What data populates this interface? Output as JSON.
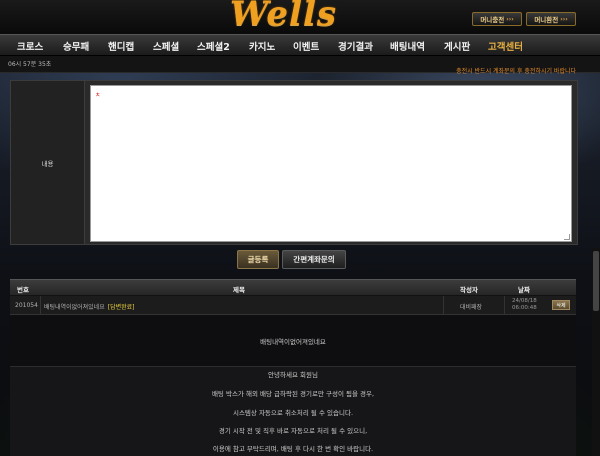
{
  "header": {
    "logo": "Wells",
    "charge_btn": "머니충전",
    "exchange_btn": "머니환전",
    "arrows": "›››"
  },
  "nav": {
    "items": [
      {
        "label": "크로스"
      },
      {
        "label": "승무패"
      },
      {
        "label": "핸디캡"
      },
      {
        "label": "스페셜"
      },
      {
        "label": "스페셜2"
      },
      {
        "label": "카지노"
      },
      {
        "label": "이벤트"
      },
      {
        "label": "경기결과"
      },
      {
        "label": "배팅내역"
      },
      {
        "label": "게시판"
      },
      {
        "label": "고객센터"
      }
    ],
    "active": "고객센터"
  },
  "status": {
    "clock": "06시 57분 35초",
    "notice": "충전시 반드시 계좌문의 후 충전하시기 바랍니다"
  },
  "form": {
    "label": "내용",
    "editor_value": "ㅊ"
  },
  "buttons": {
    "submit": "글등록",
    "account_inquiry": "간편계좌문의"
  },
  "table": {
    "headers": {
      "no": "번호",
      "title": "제목",
      "author": "작성자",
      "date": "날짜"
    },
    "rows": [
      {
        "no": "201054",
        "title": "배팅내역이없어져있네요",
        "badge": "[답변완료]",
        "author": "대비패장",
        "date_line1": "24/08/18",
        "date_line2": "06:00:48",
        "delete": "삭제"
      }
    ],
    "detail": "배팅내역이없어져있네요",
    "reply_lines": [
      "안녕하세요 회원님",
      "배팅 박스가 해외 배당 급하락된 경기로만 구성이 됨을 경우,",
      "시스템상 자동으로 취소처리 될 수 있습니다.",
      "경기 시작 전 및 직후 바로 자동으로 처리 될 수 있으니,",
      "이용에 참고 부탁드리며, 배팅 후 다시 한 번 확인 바랍니다."
    ]
  }
}
